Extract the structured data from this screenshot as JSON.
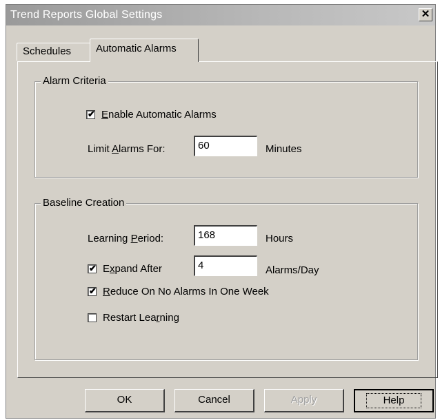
{
  "window": {
    "title": "Trend Reports Global Settings",
    "close_glyph": "✕"
  },
  "tabs": [
    {
      "label": "Schedules",
      "active": false
    },
    {
      "label": "Automatic Alarms",
      "active": true
    }
  ],
  "alarm_criteria": {
    "title": "Alarm Criteria",
    "enable": {
      "prefix": "",
      "underlined": "E",
      "suffix": "nable Automatic Alarms",
      "checked": true
    },
    "limit": {
      "prefix": "Limit ",
      "underlined": "A",
      "suffix": "larms For:",
      "value": "60",
      "unit": "Minutes"
    }
  },
  "baseline_creation": {
    "title": "Baseline Creation",
    "learning": {
      "prefix": "Learning ",
      "underlined": "P",
      "suffix": "eriod:",
      "value": "168",
      "unit": "Hours"
    },
    "expand": {
      "prefix": "E",
      "underlined": "x",
      "suffix": "pand After",
      "checked": true,
      "value": "4",
      "unit": "Alarms/Day"
    },
    "reduce": {
      "prefix": "",
      "underlined": "R",
      "suffix": "educe On No Alarms In One Week",
      "checked": true
    },
    "restart": {
      "prefix": "Restart Lea",
      "underlined": "r",
      "suffix": "ning",
      "checked": false
    }
  },
  "buttons": {
    "ok": "OK",
    "cancel": "Cancel",
    "apply": "Apply",
    "help": "Help"
  },
  "check_glyph": "✔"
}
